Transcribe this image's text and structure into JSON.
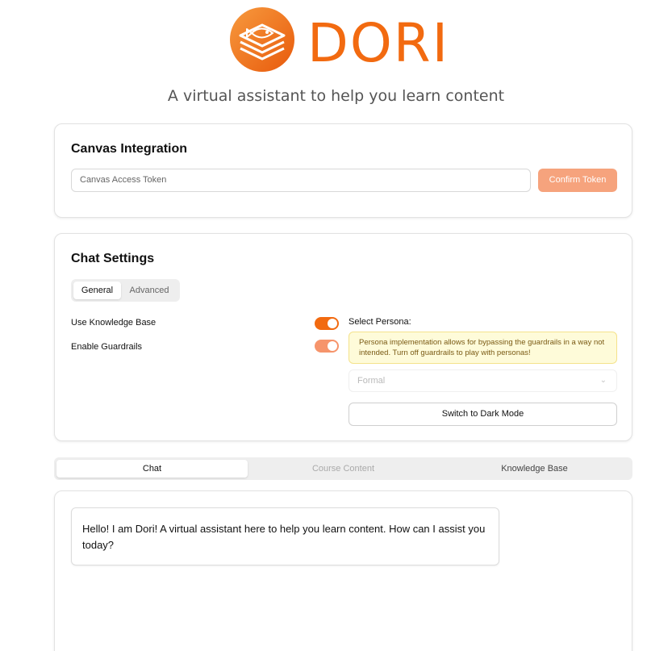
{
  "brand": {
    "name": "DORI",
    "tagline": "A virtual assistant to help you learn content",
    "accent_color": "#f26a10"
  },
  "canvas_integration": {
    "title": "Canvas Integration",
    "token_placeholder": "Canvas Access Token",
    "confirm_label": "Confirm Token"
  },
  "chat_settings": {
    "title": "Chat Settings",
    "tabs": [
      {
        "label": "General",
        "active": true
      },
      {
        "label": "Advanced",
        "active": false
      }
    ],
    "toggles": [
      {
        "label": "Use Knowledge Base",
        "on": true
      },
      {
        "label": "Enable Guardrails",
        "on": true
      }
    ],
    "persona_label": "Select Persona:",
    "persona_warning": "Persona implementation allows for bypassing the guardrails in a way not intended. Turn off guardrails to play with personas!",
    "persona_value": "Formal",
    "dark_mode_label": "Switch to Dark Mode"
  },
  "main_tabs": [
    {
      "label": "Chat",
      "state": "active"
    },
    {
      "label": "Course Content",
      "state": "disabled"
    },
    {
      "label": "Knowledge Base",
      "state": "inactive"
    }
  ],
  "chat": {
    "messages": [
      {
        "sender": "assistant",
        "text": "Hello! I am Dori! A virtual assistant here to help you learn content. How can I assist you today?"
      }
    ]
  }
}
